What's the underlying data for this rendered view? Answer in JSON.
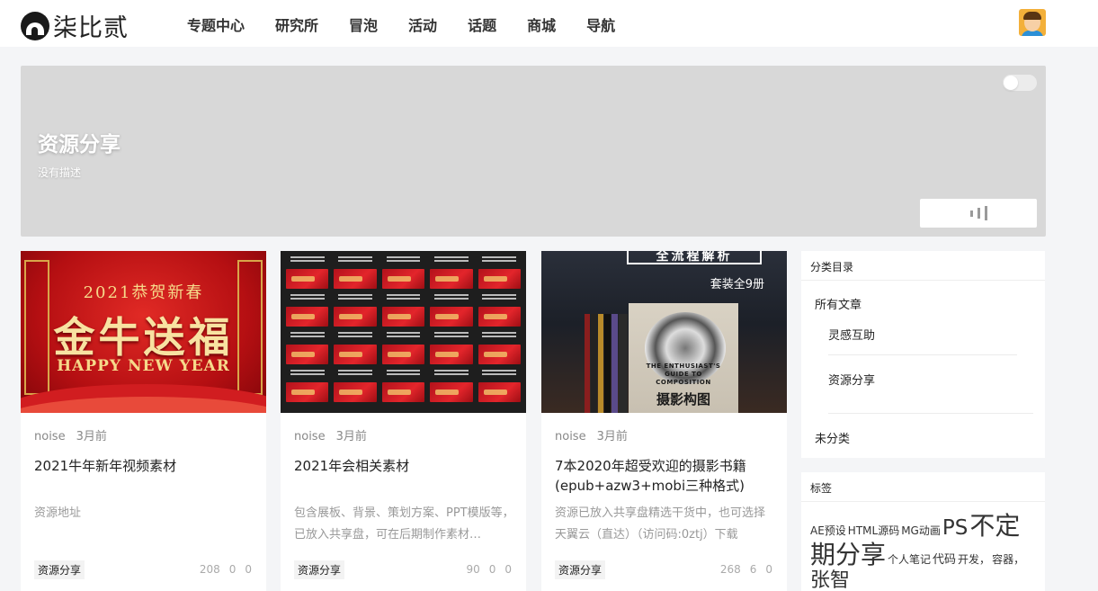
{
  "header": {
    "logo_text": "柒比贰",
    "nav": [
      "专题中心",
      "研究所",
      "冒泡",
      "活动",
      "话题",
      "商城",
      "导航"
    ]
  },
  "banner": {
    "title": "资源分享",
    "description": "没有描述"
  },
  "cards": [
    {
      "author": "noise",
      "time": "3月前",
      "title": "2021牛年新年视频素材",
      "excerpt": "资源地址",
      "category": "资源分享",
      "views": "208",
      "comments": "0",
      "likes": "0",
      "thumb_text": {
        "line1": "2021恭贺新春",
        "line2": "金牛送福",
        "line3": "HAPPY NEW YEAR"
      }
    },
    {
      "author": "noise",
      "time": "3月前",
      "title": "2021年会相关素材",
      "excerpt": "包含展板、背景、策划方案、PPT模版等，已放入共享盘，可在后期制作素材…",
      "category": "资源分享",
      "views": "90",
      "comments": "0",
      "likes": "0"
    },
    {
      "author": "noise",
      "time": "3月前",
      "title": "7本2020年超受欢迎的摄影书籍(epub+azw3+mobi三种格式)",
      "excerpt": "资源已放入共享盘精选干货中，也可选择天翼云（直达）（访问码:0ztj）下载",
      "category": "资源分享",
      "views": "268",
      "comments": "6",
      "likes": "0",
      "thumb_text": {
        "top": "全流程解析",
        "tag": "套装全9册",
        "book_en": "THE ENTHUSIAST'S GUIDE TO COMPOSITION",
        "book_cn": "摄影构图"
      }
    }
  ],
  "sidebar": {
    "categories": {
      "heading": "分类目录",
      "all": "所有文章",
      "children": [
        "灵感互助",
        "资源分享"
      ],
      "uncategorized": "未分类"
    },
    "tags": {
      "heading": "标签",
      "items": [
        {
          "label": "AE预设",
          "size": 12
        },
        {
          "label": "HTML源码",
          "size": 12
        },
        {
          "label": "MG动画",
          "size": 12
        },
        {
          "label": "PS",
          "size": 23
        },
        {
          "label": "不定期分享",
          "size": 28
        },
        {
          "label": "个人笔记",
          "size": 12
        },
        {
          "label": "代码",
          "size": 13
        },
        {
          "label": "开发，",
          "size": 12
        },
        {
          "label": "容器，",
          "size": 12
        },
        {
          "label": "张智",
          "size": 22
        }
      ]
    }
  }
}
